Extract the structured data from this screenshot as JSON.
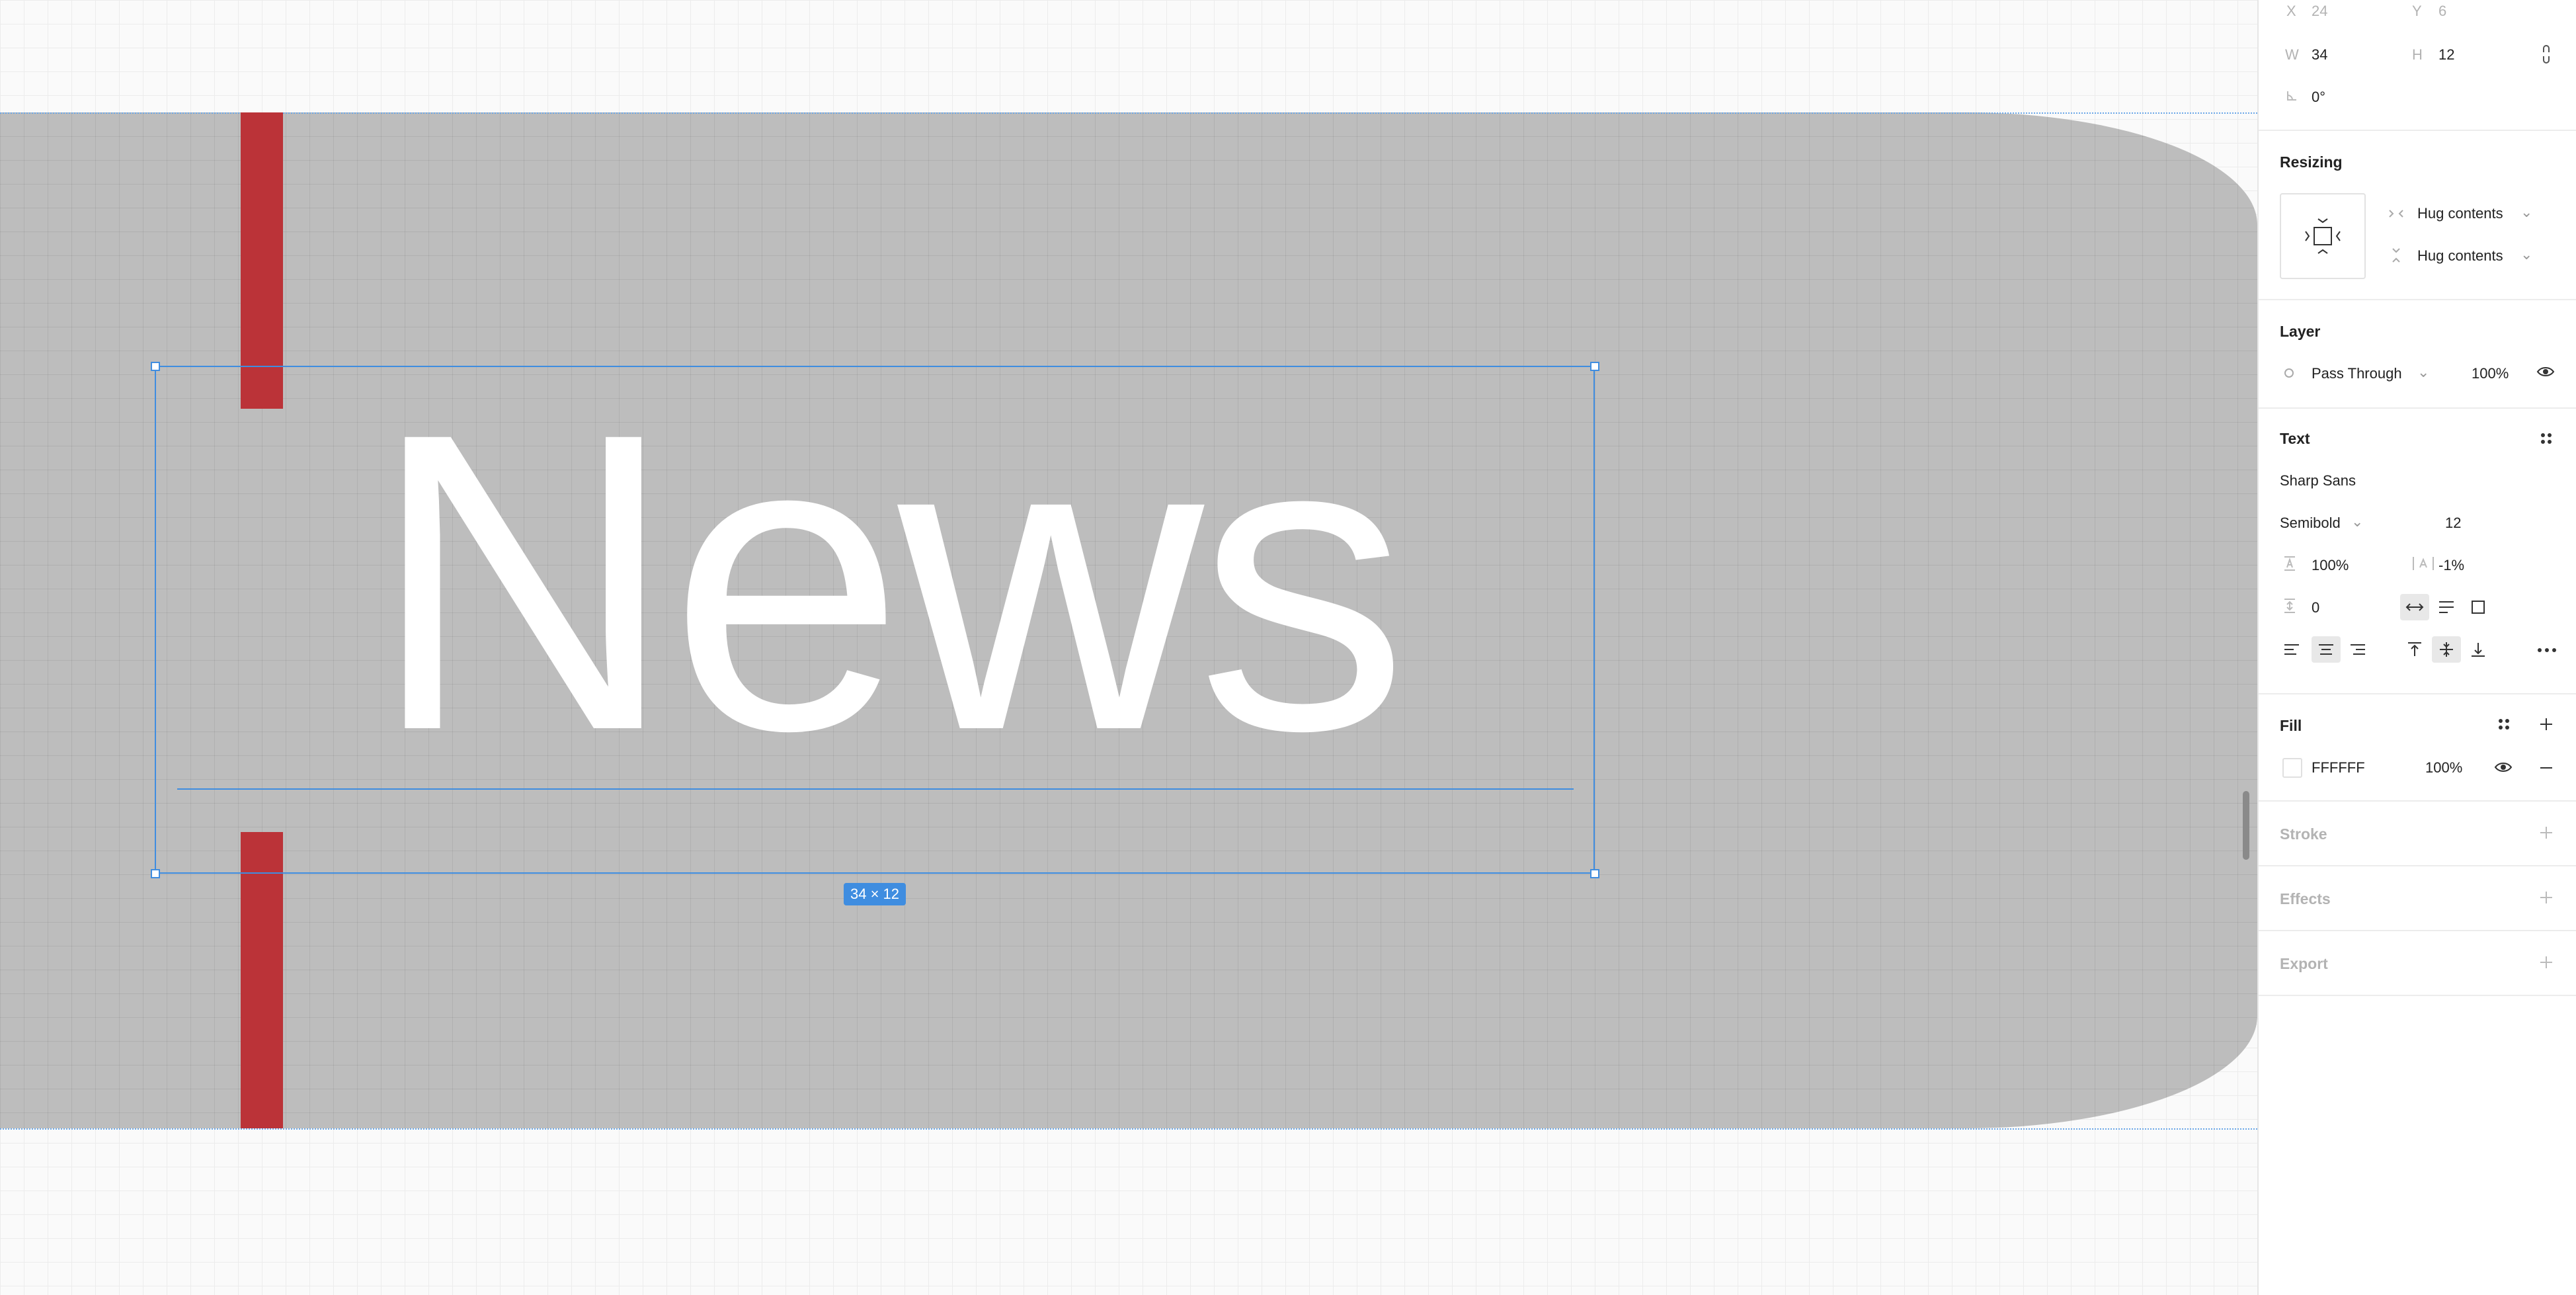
{
  "canvas": {
    "text_content": "News",
    "size_badge": "34 × 12",
    "colors": {
      "frame": "#bdbdbd",
      "accent_bar": "#bb3338",
      "selection": "#3f8de0",
      "text": "#ffffff"
    }
  },
  "panel": {
    "position": {
      "x_label": "X",
      "x_value": "24",
      "y_label": "Y",
      "y_value": "6"
    },
    "dimensions": {
      "w_label": "W",
      "w_value": "34",
      "h_label": "H",
      "h_value": "12"
    },
    "rotation": {
      "value": "0°"
    },
    "resizing": {
      "title": "Resizing",
      "horizontal": "Hug contents",
      "vertical": "Hug contents"
    },
    "layer": {
      "title": "Layer",
      "blend_mode": "Pass Through",
      "opacity": "100%"
    },
    "text": {
      "title": "Text",
      "font_family": "Sharp Sans",
      "font_weight": "Semibold",
      "font_size": "12",
      "line_height": "100%",
      "letter_spacing": "-1%",
      "paragraph_spacing": "0"
    },
    "fill": {
      "title": "Fill",
      "hex": "FFFFFF",
      "opacity": "100%"
    },
    "stroke": {
      "title": "Stroke"
    },
    "effects": {
      "title": "Effects"
    },
    "export": {
      "title": "Export"
    }
  }
}
